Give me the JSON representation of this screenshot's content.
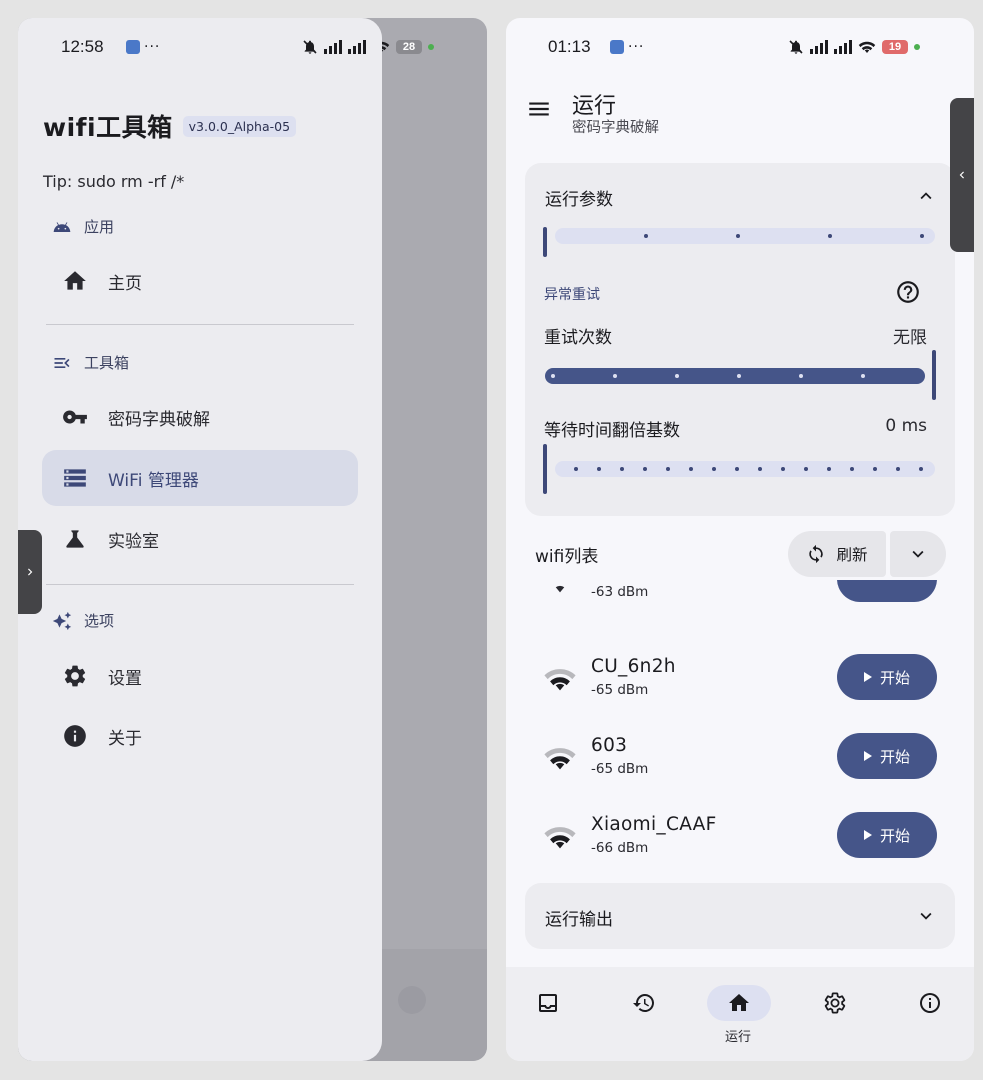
{
  "left_screen": {
    "status": {
      "time": "12:58",
      "dots": "···",
      "battery": "28"
    },
    "app_title": "wifi工具箱",
    "version": "v3.0.0_Alpha-05",
    "tip": "Tip: sudo rm -rf /*",
    "sections": {
      "apps": "应用",
      "toolbox": "工具箱",
      "options": "选项"
    },
    "nav": {
      "home": "主页",
      "dict_crack": "密码字典破解",
      "wifi_manager": "WiFi 管理器",
      "lab": "实验室",
      "settings": "设置",
      "about": "关于"
    }
  },
  "right_screen": {
    "status": {
      "time": "01:13",
      "dots": "···",
      "battery": "19"
    },
    "title": "运行",
    "subtitle": "密码字典破解",
    "params_card": {
      "title": "运行参数",
      "section_retry": "异常重试",
      "retry_count_label": "重试次数",
      "retry_count_value": "无限",
      "retry_count_level": 1.0,
      "wait_label": "等待时间翻倍基数",
      "wait_value": "0 ms",
      "wait_level": 0.0,
      "top_slider_level": 0.0
    },
    "wifi_list": {
      "title": "wifi列表",
      "refresh": "刷新",
      "items": [
        {
          "ssid": "",
          "rssi": "-63 dBm",
          "button": ""
        },
        {
          "ssid": "CU_6n2h",
          "rssi": "-65 dBm",
          "button": "开始"
        },
        {
          "ssid": "603",
          "rssi": "-65 dBm",
          "button": "开始"
        },
        {
          "ssid": "Xiaomi_CAAF",
          "rssi": "-66 dBm",
          "button": "开始"
        }
      ]
    },
    "output_card": {
      "title": "运行输出"
    },
    "bottom_nav": {
      "items": [
        {
          "icon": "inbox-icon",
          "label": ""
        },
        {
          "icon": "history-icon",
          "label": ""
        },
        {
          "icon": "home-icon",
          "label": "运行",
          "active": true
        },
        {
          "icon": "settings-icon",
          "label": ""
        },
        {
          "icon": "info-icon",
          "label": ""
        }
      ]
    }
  },
  "colors": {
    "primary": "#455589",
    "primary_container": "#dde0f1",
    "surface": "#f7f7fb",
    "card": "#ececf0"
  }
}
